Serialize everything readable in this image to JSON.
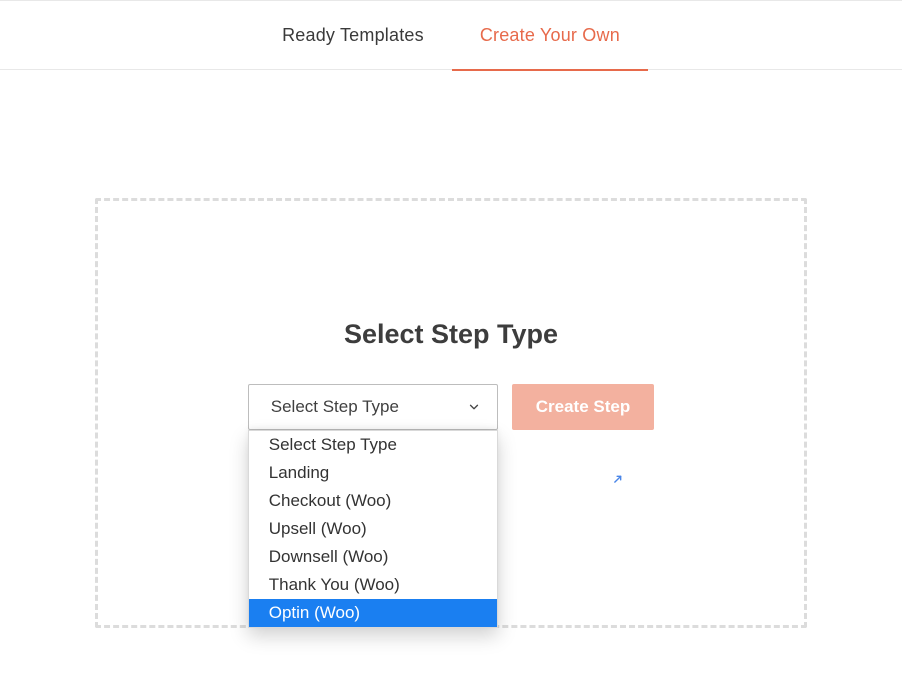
{
  "tabs": {
    "ready_templates": "Ready Templates",
    "create_your_own": "Create Your Own",
    "active": "create_your_own"
  },
  "panel": {
    "heading": "Select Step Type",
    "create_button": "Create Step"
  },
  "step_select": {
    "selected_label": "Select Step Type",
    "highlighted_index": 6,
    "options": [
      "Select Step Type",
      "Landing",
      "Checkout (Woo)",
      "Upsell (Woo)",
      "Downsell (Woo)",
      "Thank You (Woo)",
      "Optin (Woo)"
    ]
  }
}
